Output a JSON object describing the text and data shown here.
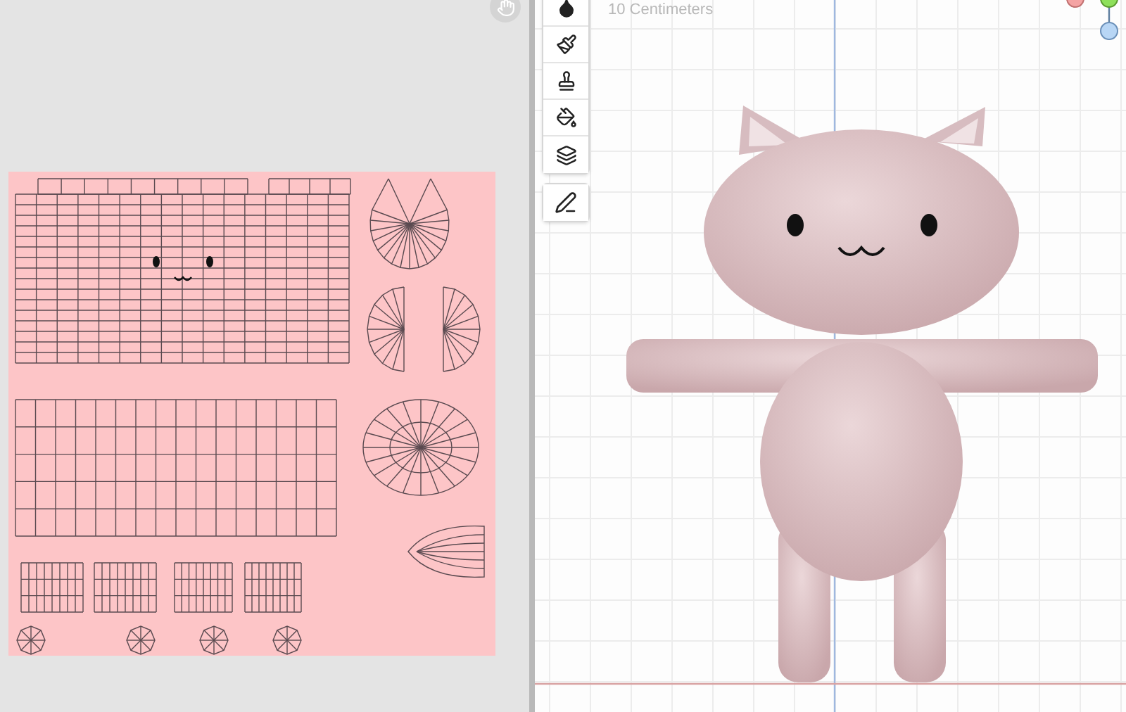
{
  "viewport": {
    "scale_label": "10 Centimeters"
  }
}
